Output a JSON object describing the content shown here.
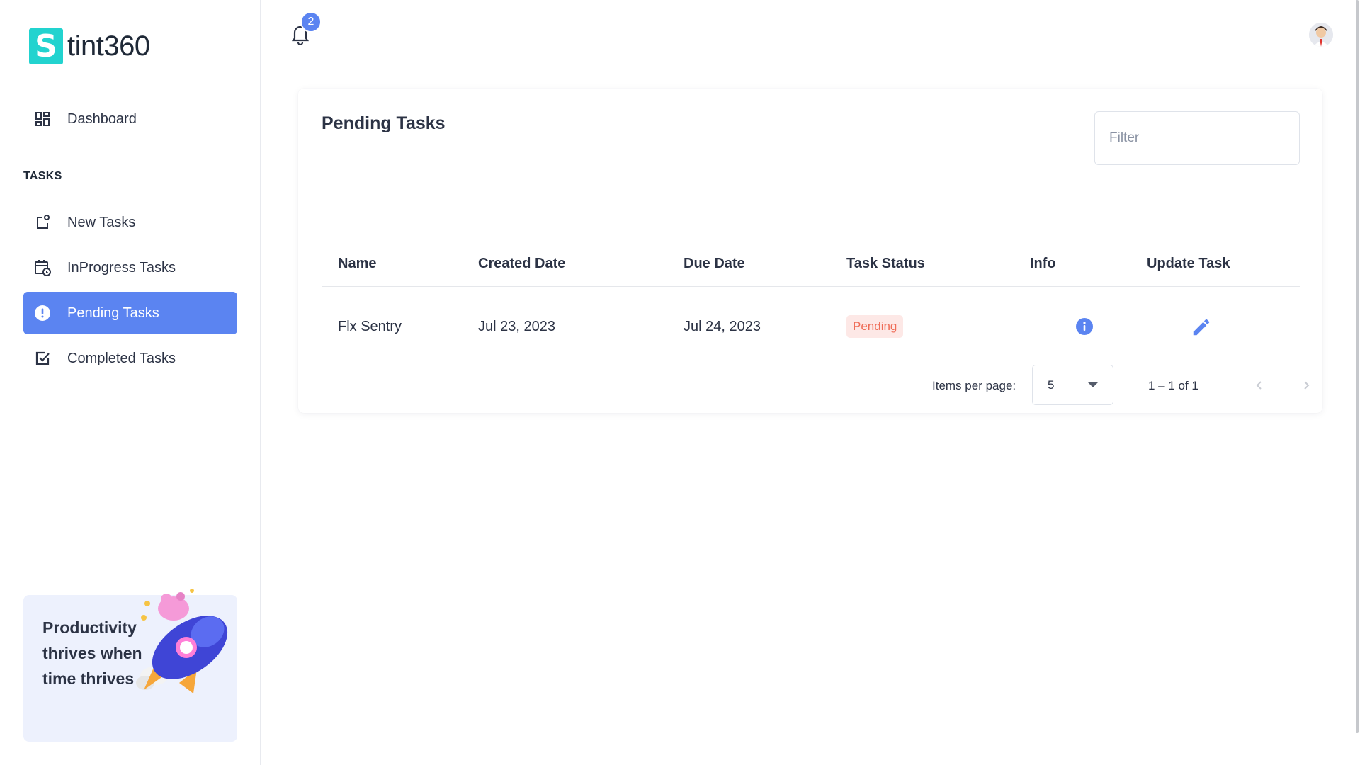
{
  "app": {
    "logo_letter": "S",
    "logo_text": "tint360"
  },
  "sidebar": {
    "dashboard_label": "Dashboard",
    "section_label": "TASKS",
    "items": [
      {
        "label": "New Tasks",
        "icon": "new-task-icon"
      },
      {
        "label": "InProgress Tasks",
        "icon": "calendar-clock-icon"
      },
      {
        "label": "Pending Tasks",
        "icon": "alert-circle-icon",
        "active": true
      },
      {
        "label": "Completed Tasks",
        "icon": "check-square-icon"
      }
    ],
    "promo_text": "Productivity thrives when time thrives"
  },
  "header": {
    "notification_count": "2"
  },
  "card": {
    "title": "Pending Tasks",
    "filter_placeholder": "Filter",
    "columns": [
      "Name",
      "Created Date",
      "Due Date",
      "Task Status",
      "Info",
      "Update Task"
    ],
    "rows": [
      {
        "name": "Flx Sentry",
        "created": "Jul 23, 2023",
        "due": "Jul 24, 2023",
        "status": "Pending"
      }
    ],
    "paginator": {
      "label": "Items per page:",
      "page_size": "5",
      "range": "1 – 1 of 1"
    }
  },
  "colors": {
    "accent": "#5b84f1",
    "logo": "#22d3cf",
    "status_pending_bg": "#fde8e6",
    "status_pending_text": "#ef6c57"
  }
}
